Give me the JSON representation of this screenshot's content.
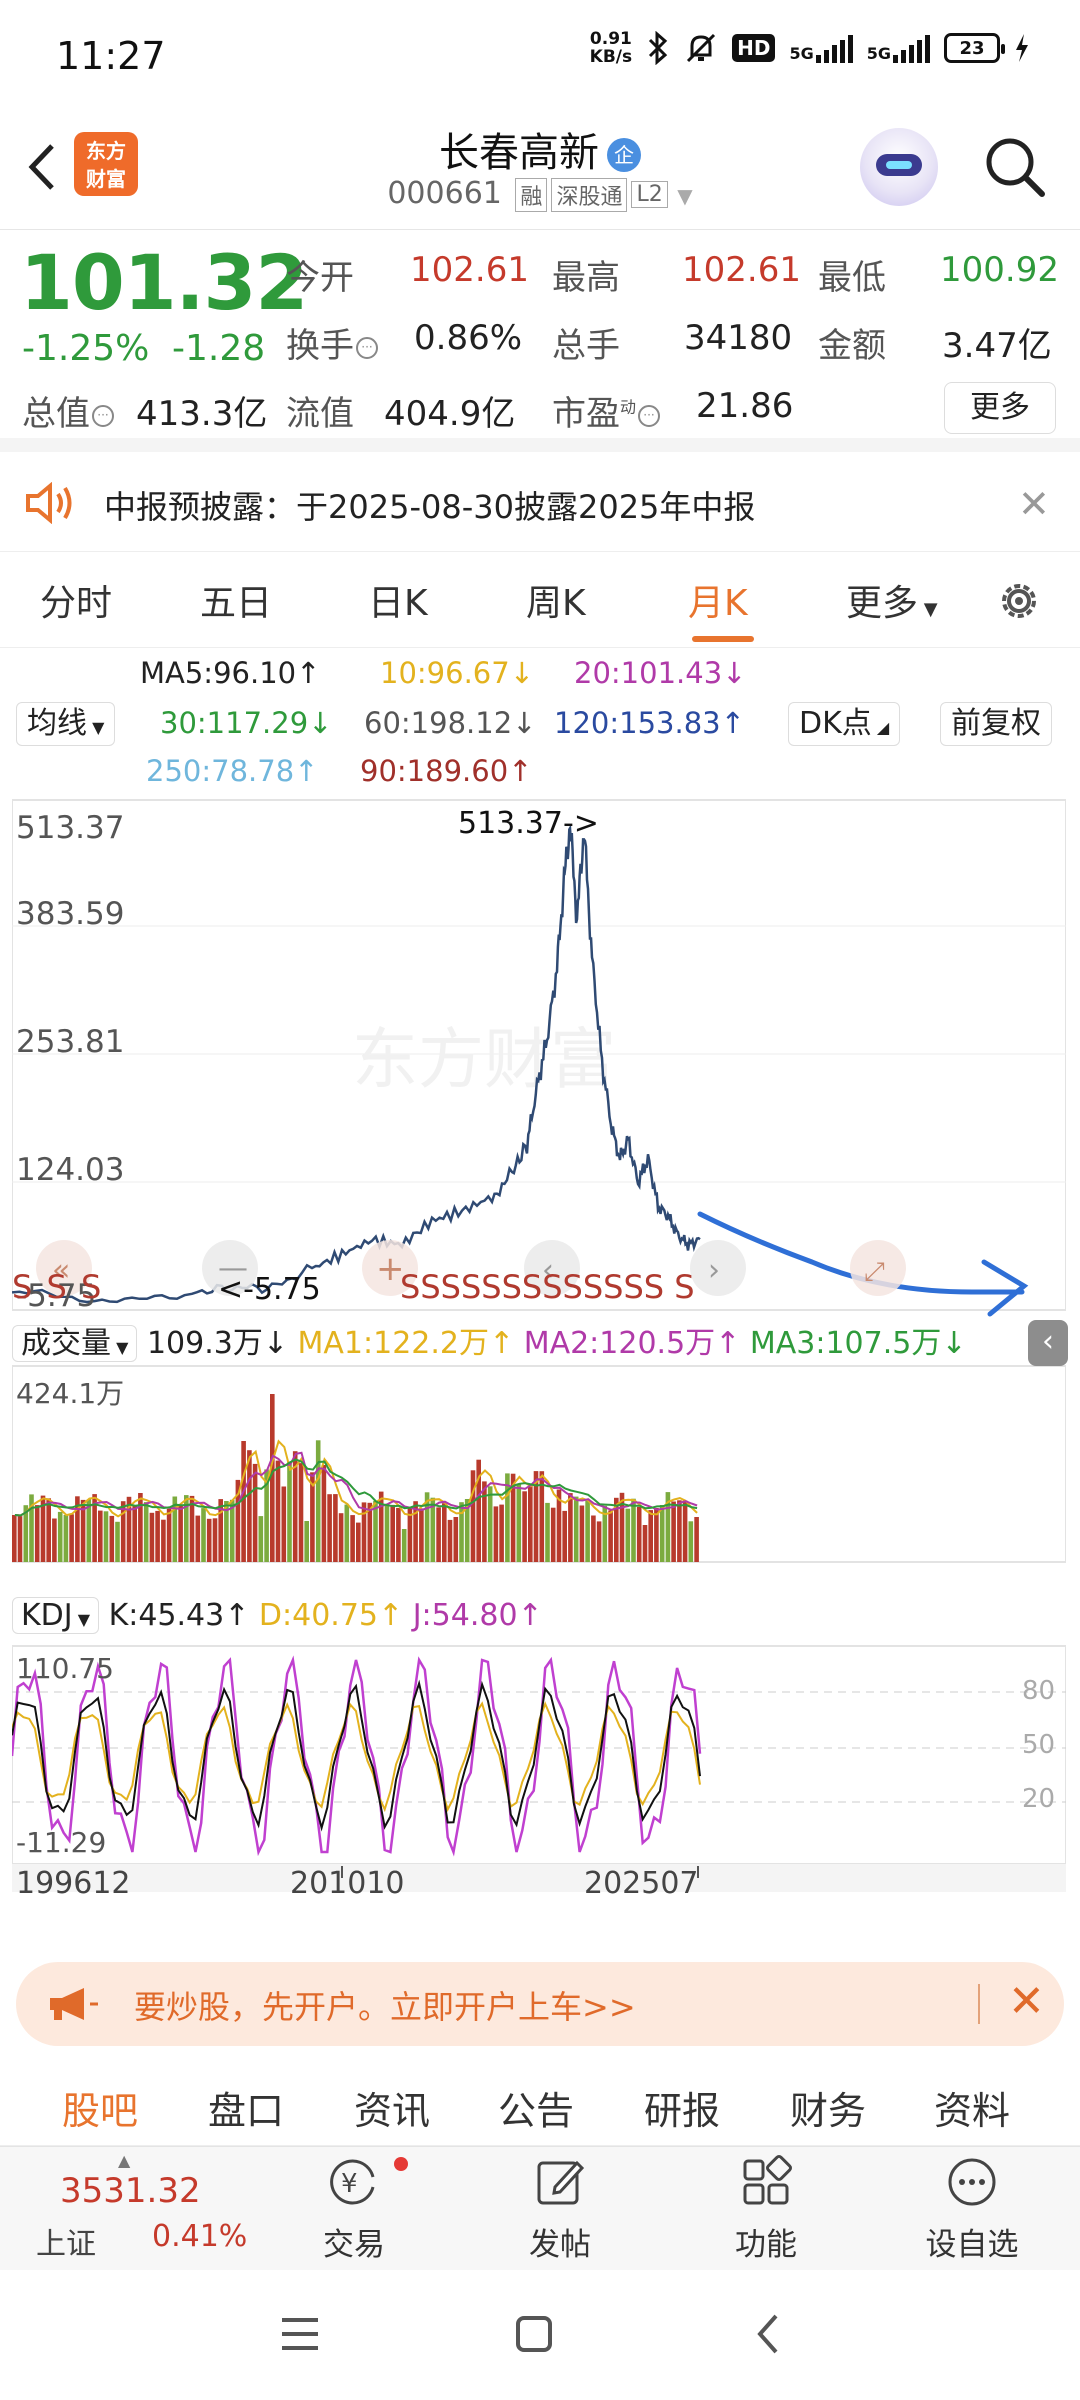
{
  "status_bar": {
    "time": "11:27",
    "net_speed": "0.91",
    "net_unit": "KB/s",
    "hd_label": "HD",
    "sig1_label": "5G",
    "sig2_label": "5G",
    "battery": "23"
  },
  "header": {
    "logo_text_1": "东方",
    "logo_text_2": "财富",
    "stock_name": "长春高新",
    "qi_badge": "企",
    "stock_code": "000661",
    "tag_margin": "融",
    "tag_connect": "深股通",
    "tag_level": "L2"
  },
  "quote": {
    "price": "101.32",
    "change_pct": "-1.25%",
    "change_amt": "-1.28",
    "open_label": "今开",
    "open": "102.61",
    "high_label": "最高",
    "high": "102.61",
    "low_label": "最低",
    "low": "100.92",
    "turnover_label": "换手",
    "turnover": "0.86%",
    "volume_label": "总手",
    "volume": "34180",
    "amount_label": "金额",
    "amount": "3.47亿",
    "mcap_label": "总值",
    "mcap": "413.3亿",
    "float_label": "流值",
    "float_mcap": "404.9亿",
    "pe_label": "市盈",
    "pe_sup": "动",
    "pe": "21.86",
    "more_label": "更多"
  },
  "notice": {
    "text": "中报预披露：于2025-08-30披露2025年中报"
  },
  "period_tabs": [
    "分时",
    "五日",
    "日K",
    "周K",
    "月K",
    "更多"
  ],
  "active_tab": "月K",
  "ma": {
    "ma5": "MA5:96.10↑",
    "ma10": "10:96.67↓",
    "ma20": "20:101.43↓",
    "ma30": "30:117.29↓",
    "ma60": "60:198.12↓",
    "ma120": "120:153.83↑",
    "ma250": "250:78.78↑",
    "ma90": "90:189.60↑",
    "avg_btn": "均线",
    "dk_btn": "DK点",
    "adjust_btn": "前复权"
  },
  "price_axis": [
    "513.37",
    "383.59",
    "253.81",
    "124.03",
    "-5.75"
  ],
  "chart_annot": {
    "max_label": "513.37->",
    "min_label": "<-5.75",
    "s_markers_left": "S  S  S",
    "s_markers_right": "SSSSSSSSSSSSS S",
    "watermark": "东方财富"
  },
  "volume": {
    "label": "成交量",
    "value": "109.3万↓",
    "ma1": "MA1:122.2万↑",
    "ma2": "MA2:120.5万↑",
    "ma3": "MA3:107.5万↓",
    "axis_max": "424.1万"
  },
  "kdj": {
    "label": "KDJ",
    "k": "K:45.43↑",
    "d": "D:40.75↑",
    "j": "J:54.80↑",
    "axis_max": "110.75",
    "axis_min": "-11.29",
    "lvl80": "80",
    "lvl50": "50",
    "lvl20": "20"
  },
  "dates": [
    "199612",
    "201010",
    "202507"
  ],
  "banner": {
    "text": "要炒股，先开户。立即开户上车>>"
  },
  "section_tabs": [
    "股吧",
    "盘口",
    "资讯",
    "公告",
    "研报",
    "财务",
    "资料"
  ],
  "active_section": "股吧",
  "toolbar": {
    "index_value": "3531.32",
    "index_name": "上证",
    "index_pct": "0.41%",
    "trade": "交易",
    "post": "发帖",
    "func": "功能",
    "watch": "设自选"
  },
  "colors": {
    "up_red": "#c53a2b",
    "down_green": "#2f9a3b",
    "accent_orange": "#e8742e",
    "price_line": "#2f4a73",
    "annotation_blue": "#2f6fd6",
    "ma_yellow": "#e3b21e",
    "ma_purple": "#b03aa8"
  }
}
